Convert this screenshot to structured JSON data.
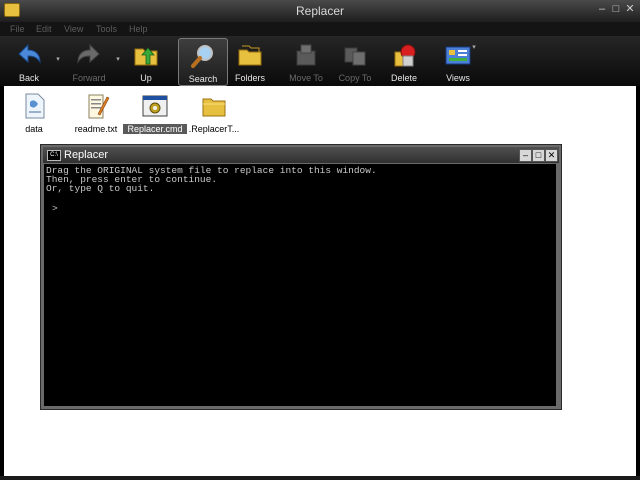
{
  "window": {
    "title": "Replacer"
  },
  "menu": [
    "File",
    "Edit",
    "View",
    "Tools",
    "Help"
  ],
  "toolbar": {
    "back": "Back",
    "forward": "Forward",
    "up": "Up",
    "search": "Search",
    "folders": "Folders",
    "move_to": "Move To",
    "copy_to": "Copy To",
    "delete": "Delete",
    "views": "Views"
  },
  "files": [
    {
      "name": "data",
      "icon": "document-icon"
    },
    {
      "name": "readme.txt",
      "icon": "text-file-icon"
    },
    {
      "name": "Replacer.cmd",
      "icon": "cmd-script-icon",
      "selected": true
    },
    {
      "name": ".ReplacerT...",
      "icon": "folder-icon"
    }
  ],
  "console": {
    "title": "Replacer",
    "icon_text": "C:\\",
    "lines": [
      "Drag the ORIGINAL system file to replace into this window.",
      "Then, press enter to continue.",
      "Or, type Q to quit."
    ],
    "prompt": ">"
  }
}
